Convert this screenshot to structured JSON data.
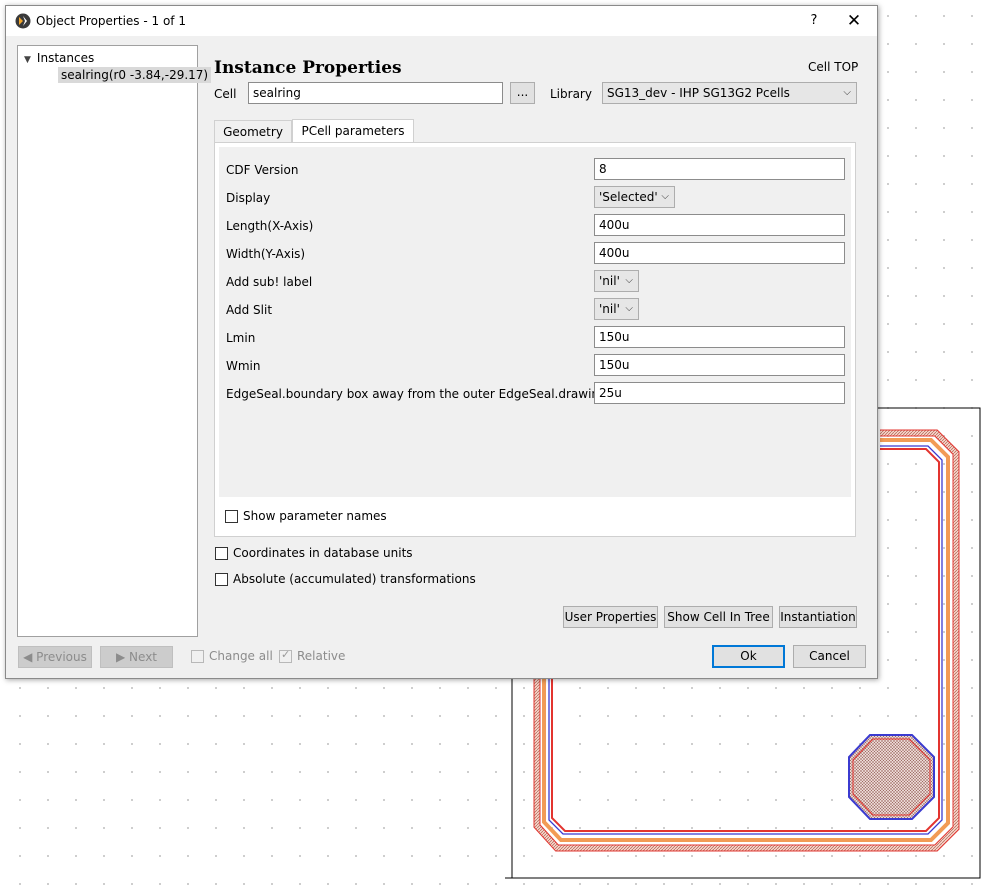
{
  "window": {
    "title": "Object Properties - 1 of 1",
    "help": "?",
    "close": "✕"
  },
  "tree": {
    "root": "Instances",
    "child": "sealring(r0 -3.84,-29.17)"
  },
  "heading": "Instance Properties",
  "cell_top": "Cell TOP",
  "cell": {
    "label": "Cell",
    "value": "sealring",
    "browse": "..."
  },
  "library": {
    "label": "Library",
    "value": "SG13_dev - IHP SG13G2 Pcells"
  },
  "tabs": [
    "Geometry",
    "PCell parameters"
  ],
  "params": [
    {
      "label": "CDF Version",
      "value": "8",
      "kind": "text"
    },
    {
      "label": "Display",
      "value": "'Selected'",
      "kind": "combo"
    },
    {
      "label": "Length(X-Axis)",
      "value": "400u",
      "kind": "text"
    },
    {
      "label": "Width(Y-Axis)",
      "value": "400u",
      "kind": "text"
    },
    {
      "label": "Add sub! label",
      "value": "'nil'",
      "kind": "combo"
    },
    {
      "label": "Add Slit",
      "value": "'nil'",
      "kind": "combo"
    },
    {
      "label": "Lmin",
      "value": "150u",
      "kind": "text"
    },
    {
      "label": "Wmin",
      "value": "150u",
      "kind": "text"
    },
    {
      "label": "EdgeSeal.boundary box away from the outer EdgeSeal.drawing",
      "value": "25u",
      "kind": "text"
    }
  ],
  "show_param_names": "Show parameter names",
  "coords_db_units": "Coordinates in database units",
  "absolute_transforms": "Absolute (accumulated) transformations",
  "buttons": {
    "user_properties": "User Properties",
    "show_cell_in_tree": "Show Cell In Tree",
    "instantiation": "Instantiation",
    "previous": "Previous",
    "next": "Next",
    "ok": "Ok",
    "cancel": "Cancel"
  },
  "footer": {
    "change_all": "Change all",
    "relative": "Relative"
  },
  "icons": {
    "app": "klayout-app-icon",
    "tree_expand": "triangle-down-icon",
    "combo": "chevron-down-icon",
    "prev": "arrow-left-icon",
    "next": "arrow-right-icon"
  },
  "colors": {
    "accent": "#0078d7",
    "seal_red": "#e3342f",
    "seal_orange": "#f29b55",
    "seal_blue": "#3b3bd0"
  }
}
